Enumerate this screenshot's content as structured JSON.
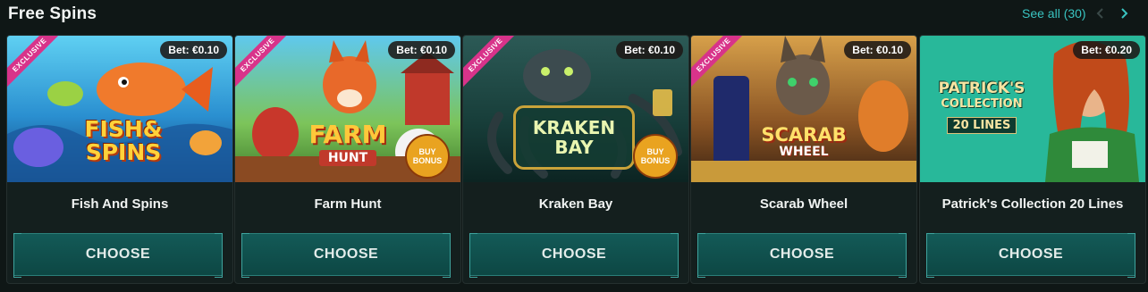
{
  "section": {
    "title": "Free Spins",
    "see_all": "See all (30)"
  },
  "colors": {
    "accent": "#39c3c0",
    "button_bg": "#135a57",
    "ribbon": "#d8338a",
    "card_bg": "#141f1e"
  },
  "cards": [
    {
      "name": "Fish And Spins",
      "bet": "Bet: €0.10",
      "ribbon": "EXCLUSIVE",
      "logo_lines": [
        "FISH&",
        "SPINS"
      ],
      "badge": "",
      "button": "CHOOSE"
    },
    {
      "name": "Farm Hunt",
      "bet": "Bet: €0.10",
      "ribbon": "EXCLUSIVE",
      "logo_lines": [
        "FARM",
        "HUNT"
      ],
      "badge": "BUY BONUS",
      "button": "CHOOSE"
    },
    {
      "name": "Kraken Bay",
      "bet": "Bet: €0.10",
      "ribbon": "EXCLUSIVE",
      "logo_lines": [
        "KRAKEN",
        "BAY"
      ],
      "badge": "BUY BONUS",
      "button": "CHOOSE"
    },
    {
      "name": "Scarab Wheel",
      "bet": "Bet: €0.10",
      "ribbon": "EXCLUSIVE",
      "logo_lines": [
        "SCARAB",
        "WHEEL"
      ],
      "badge": "",
      "button": "CHOOSE"
    },
    {
      "name": "Patrick's Collection 20 Lines",
      "bet": "Bet: €0.20",
      "ribbon": "",
      "logo_lines": [
        "PATRICK'S",
        "COLLECTION",
        "20 LINES"
      ],
      "badge": "",
      "button": "CHOOSE"
    }
  ]
}
